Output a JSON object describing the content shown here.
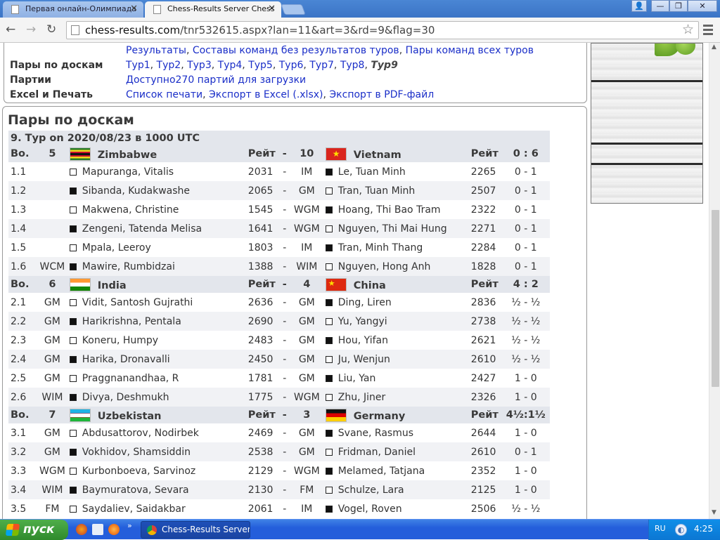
{
  "browser": {
    "tabs": [
      {
        "title": "Первая онлайн-Олимпиада"
      },
      {
        "title": "Chess-Results Server Chess"
      }
    ],
    "url_host": "chess-results.com",
    "url_path": "/tnr532615.aspx?lan=11&art=3&rd=9&flag=30"
  },
  "info": {
    "top_links": [
      "Результаты",
      "Составы команд без результатов туров",
      "Пары команд всех туров"
    ],
    "boards_label": "Пары по доскам",
    "rounds": [
      "Тур1",
      "Тур2",
      "Тур3",
      "Тур4",
      "Тур5",
      "Тур6",
      "Тур7",
      "Тур8"
    ],
    "current_round": "Тур9",
    "games_label": "Партии",
    "games_link": "Доступно270 партий для загрузки",
    "excel_label": "Excel и Печать",
    "excel_links": [
      "Список печати",
      "Экспорт в Excel (.xlsx)",
      "Экспорт в PDF-файл"
    ]
  },
  "pairings": {
    "heading": "Пары по доскам",
    "round_title": "9. Тур on 2020/08/23 в 1000 UTC",
    "header_bo": "Bo.",
    "header_rating": "Рейт",
    "header_dash": "-",
    "matches": [
      {
        "home_no": "5",
        "home_team": "Zimbabwe",
        "home_flag": "zw",
        "away_no": "10",
        "away_team": "Vietnam",
        "away_flag": "vn",
        "score": "0 : 6",
        "boards": [
          {
            "bo": "1.1",
            "t1": "",
            "c1": "w",
            "n1": "Mapuranga, Vitalis",
            "r1": "2031",
            "t2": "IM",
            "c2": "b",
            "n2": "Le, Tuan Minh",
            "r2": "2265",
            "res": "0 - 1"
          },
          {
            "bo": "1.2",
            "t1": "",
            "c1": "b",
            "n1": "Sibanda, Kudakwashe",
            "r1": "2065",
            "t2": "GM",
            "c2": "w",
            "n2": "Tran, Tuan Minh",
            "r2": "2507",
            "res": "0 - 1"
          },
          {
            "bo": "1.3",
            "t1": "",
            "c1": "w",
            "n1": "Makwena, Christine",
            "r1": "1545",
            "t2": "WGM",
            "c2": "b",
            "n2": "Hoang, Thi Bao Tram",
            "r2": "2322",
            "res": "0 - 1"
          },
          {
            "bo": "1.4",
            "t1": "",
            "c1": "b",
            "n1": "Zengeni, Tatenda Melisa",
            "r1": "1641",
            "t2": "WGM",
            "c2": "w",
            "n2": "Nguyen, Thi Mai Hung",
            "r2": "2271",
            "res": "0 - 1"
          },
          {
            "bo": "1.5",
            "t1": "",
            "c1": "w",
            "n1": "Mpala, Leeroy",
            "r1": "1803",
            "t2": "IM",
            "c2": "b",
            "n2": "Tran, Minh Thang",
            "r2": "2284",
            "res": "0 - 1"
          },
          {
            "bo": "1.6",
            "t1": "WCM",
            "c1": "b",
            "n1": "Mawire, Rumbidzai",
            "r1": "1388",
            "t2": "WIM",
            "c2": "w",
            "n2": "Nguyen, Hong Anh",
            "r2": "1828",
            "res": "0 - 1"
          }
        ]
      },
      {
        "home_no": "6",
        "home_team": "India",
        "home_flag": "in",
        "away_no": "4",
        "away_team": "China",
        "away_flag": "cn",
        "score": "4 : 2",
        "boards": [
          {
            "bo": "2.1",
            "t1": "GM",
            "c1": "w",
            "n1": "Vidit, Santosh Gujrathi",
            "r1": "2636",
            "t2": "GM",
            "c2": "b",
            "n2": "Ding, Liren",
            "r2": "2836",
            "res": "½ - ½"
          },
          {
            "bo": "2.2",
            "t1": "GM",
            "c1": "b",
            "n1": "Harikrishna, Pentala",
            "r1": "2690",
            "t2": "GM",
            "c2": "w",
            "n2": "Yu, Yangyi",
            "r2": "2738",
            "res": "½ - ½"
          },
          {
            "bo": "2.3",
            "t1": "GM",
            "c1": "w",
            "n1": "Koneru, Humpy",
            "r1": "2483",
            "t2": "GM",
            "c2": "b",
            "n2": "Hou, Yifan",
            "r2": "2621",
            "res": "½ - ½"
          },
          {
            "bo": "2.4",
            "t1": "GM",
            "c1": "b",
            "n1": "Harika, Dronavalli",
            "r1": "2450",
            "t2": "GM",
            "c2": "w",
            "n2": "Ju, Wenjun",
            "r2": "2610",
            "res": "½ - ½"
          },
          {
            "bo": "2.5",
            "t1": "GM",
            "c1": "w",
            "n1": "Praggnanandhaa, R",
            "r1": "1781",
            "t2": "GM",
            "c2": "b",
            "n2": "Liu, Yan",
            "r2": "2427",
            "res": "1 - 0"
          },
          {
            "bo": "2.6",
            "t1": "WIM",
            "c1": "b",
            "n1": "Divya, Deshmukh",
            "r1": "1775",
            "t2": "WGM",
            "c2": "w",
            "n2": "Zhu, Jiner",
            "r2": "2326",
            "res": "1 - 0"
          }
        ]
      },
      {
        "home_no": "7",
        "home_team": "Uzbekistan",
        "home_flag": "uz",
        "away_no": "3",
        "away_team": "Germany",
        "away_flag": "de",
        "score": "4½:1½",
        "boards": [
          {
            "bo": "3.1",
            "t1": "GM",
            "c1": "w",
            "n1": "Abdusattorov, Nodirbek",
            "r1": "2469",
            "t2": "GM",
            "c2": "b",
            "n2": "Svane, Rasmus",
            "r2": "2644",
            "res": "1 - 0"
          },
          {
            "bo": "3.2",
            "t1": "GM",
            "c1": "b",
            "n1": "Vokhidov, Shamsiddin",
            "r1": "2538",
            "t2": "GM",
            "c2": "w",
            "n2": "Fridman, Daniel",
            "r2": "2610",
            "res": "0 - 1"
          },
          {
            "bo": "3.3",
            "t1": "WGM",
            "c1": "w",
            "n1": "Kurbonboeva, Sarvinoz",
            "r1": "2129",
            "t2": "WGM",
            "c2": "b",
            "n2": "Melamed, Tatjana",
            "r2": "2352",
            "res": "1 - 0"
          },
          {
            "bo": "3.4",
            "t1": "WIM",
            "c1": "b",
            "n1": "Baymuratova, Sevara",
            "r1": "2130",
            "t2": "FM",
            "c2": "w",
            "n2": "Schulze, Lara",
            "r2": "2125",
            "res": "1 - 0"
          },
          {
            "bo": "3.5",
            "t1": "FM",
            "c1": "w",
            "n1": "Saydaliev, Saidakbar",
            "r1": "2061",
            "t2": "IM",
            "c2": "b",
            "n2": "Vogel, Roven",
            "r2": "2506",
            "res": "½ - ½"
          }
        ]
      }
    ]
  },
  "taskbar": {
    "start_label": "пуск",
    "task_title": "Chess-Results Server...",
    "lang": "RU",
    "clock": "4:25"
  }
}
